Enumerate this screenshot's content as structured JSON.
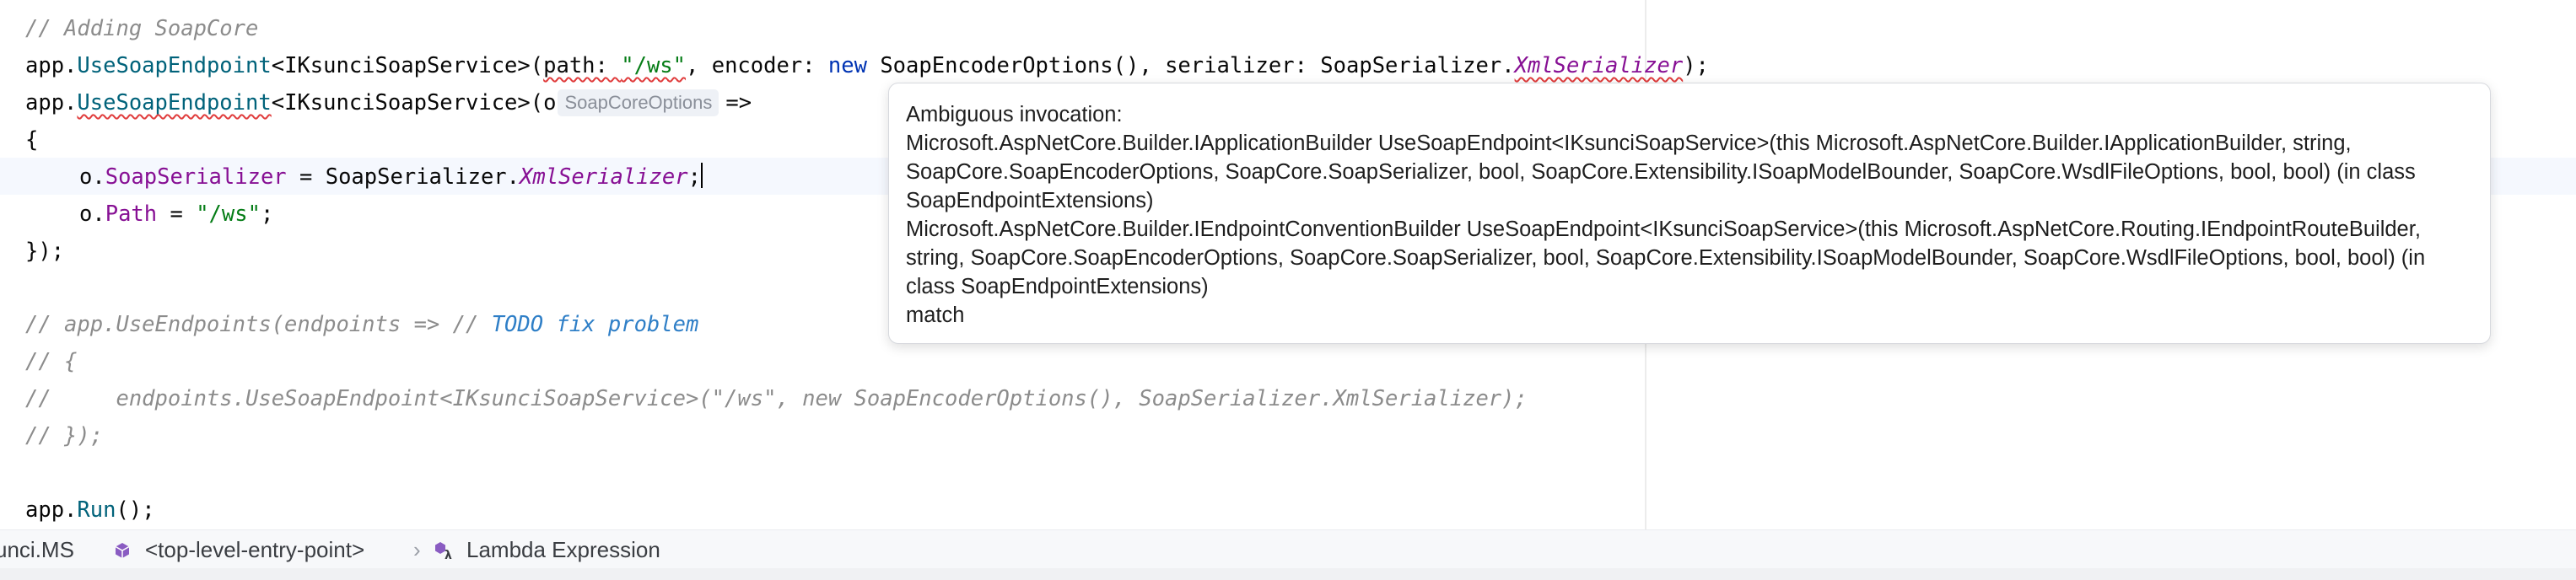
{
  "editor": {
    "lines": {
      "l1": {
        "comment": "// Adding SoapCore"
      },
      "l2": {
        "p1": "app.",
        "method": "UseSoapEndpoint",
        "p2": "<IKsunciSoapService>(",
        "path_name": "path:",
        "path_value": "\"/ws\"",
        "p3": ", encoder: ",
        "kw_new": "new",
        "p4": " SoapEncoderOptions(), serializer: SoapSerializer.",
        "serializer_member": "XmlSerializer",
        "p5": ");"
      },
      "l3": {
        "p1": "app.",
        "method": "UseSoapEndpoint",
        "p2": "<IKsunciSoapService>(o",
        "type_hint": "SoapCoreOptions",
        "arrow": "=>"
      },
      "l4": {
        "text": "{"
      },
      "l5": {
        "p1": "o.",
        "prop": "SoapSerializer",
        "p2": " = SoapSerializer.",
        "member": "XmlSerializer",
        "p3": ";"
      },
      "l6": {
        "p1": "o.",
        "prop": "Path",
        "p2": " = ",
        "str": "\"/ws\"",
        "p3": ";"
      },
      "l7": {
        "text": "});"
      },
      "l9": {
        "comment": "// app.UseEndpoints(endpoints => // ",
        "todo": "TODO fix problem"
      },
      "l10": {
        "comment": "// {"
      },
      "l11": {
        "comment": "//     endpoints.UseSoapEndpoint<IKsunciSoapService>(\"/ws\", new SoapEncoderOptions(), SoapSerializer.XmlSerializer);"
      },
      "l12": {
        "comment": "// });"
      },
      "l14": {
        "p1": "app.",
        "method": "Run",
        "p2": "();"
      }
    }
  },
  "popup": {
    "title": "Ambiguous invocation:",
    "candidate1": "Microsoft.AspNetCore.Builder.IApplicationBuilder UseSoapEndpoint<IKsunciSoapService>(this Microsoft.AspNetCore.Builder.IApplicationBuilder, string, SoapCore.SoapEncoderOptions, SoapCore.SoapSerializer, bool, SoapCore.Extensibility.ISoapModelBounder, SoapCore.WsdlFileOptions, bool, bool) (in class SoapEndpointExtensions)",
    "candidate2": "Microsoft.AspNetCore.Builder.IEndpointConventionBuilder UseSoapEndpoint<IKsunciSoapService>(this Microsoft.AspNetCore.Routing.IEndpointRouteBuilder, string, SoapCore.SoapEncoderOptions, SoapCore.SoapSerializer, bool, SoapCore.Extensibility.ISoapModelBounder, SoapCore.WsdlFileOptions, bool, bool) (in class SoapEndpointExtensions)",
    "footer": "match"
  },
  "breadcrumbs": {
    "project": "unci.MS",
    "entry": "<top-level-entry-point>",
    "separator": "›",
    "lambda": "Lambda Expression"
  },
  "colors": {
    "keyword": "#0033b3",
    "method": "#00627a",
    "string": "#067d17",
    "property": "#871094",
    "comment": "#8c8c8c",
    "todo": "#2f7fc7",
    "error_underline": "#e03c3c"
  },
  "icons": {
    "entry": "cube-icon",
    "lambda": "lambda-icon"
  }
}
